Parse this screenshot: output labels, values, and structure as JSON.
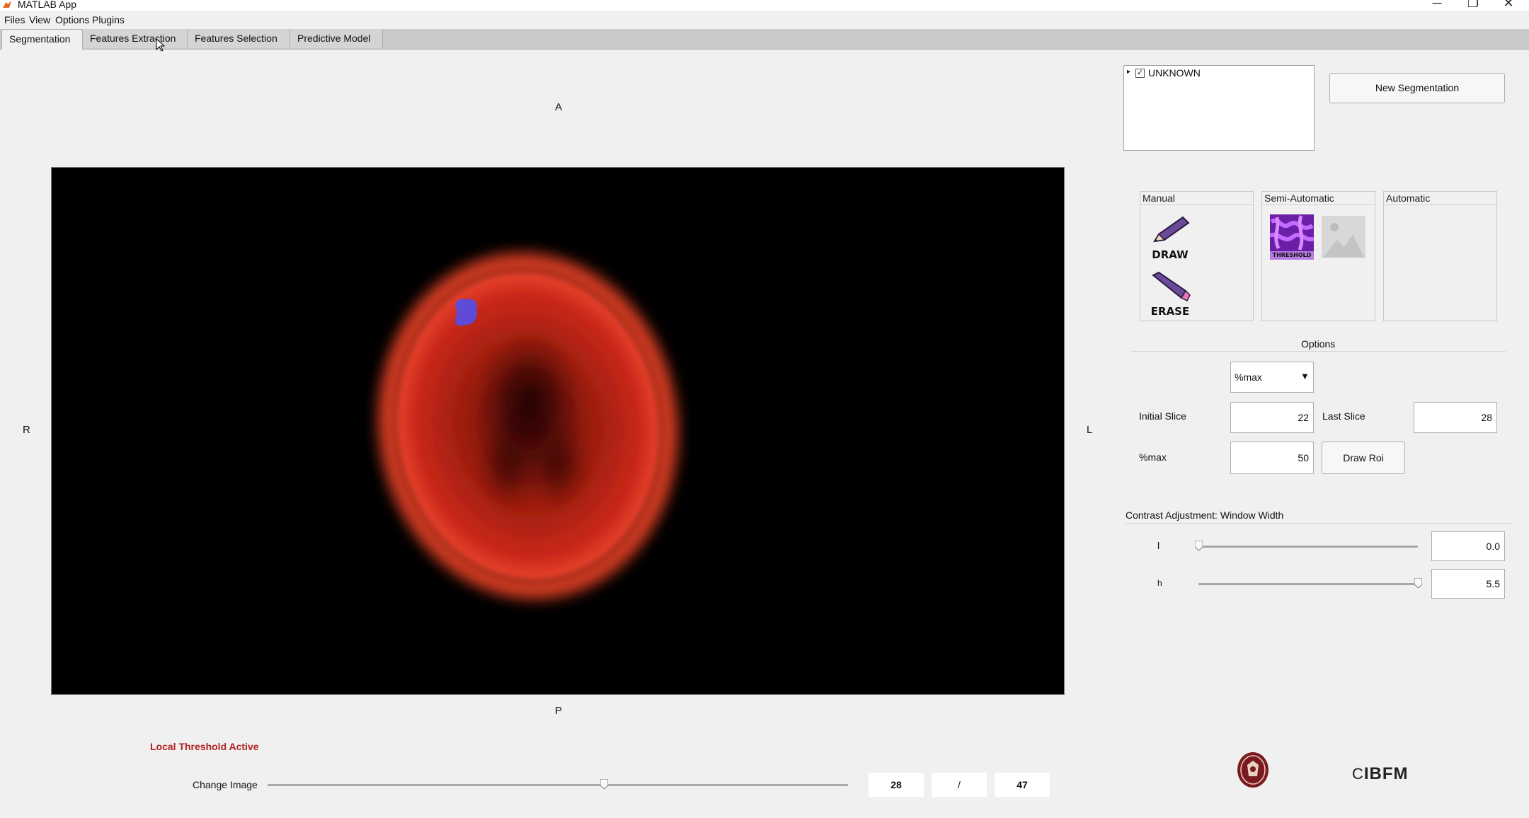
{
  "window": {
    "title": "MATLAB App",
    "minimize_glyph": "─",
    "restore_glyph": "❐",
    "close_glyph": "✕"
  },
  "menu": [
    "Files",
    "View",
    "Options",
    "Plugins"
  ],
  "tabs": [
    {
      "label": "Segmentation",
      "active": true
    },
    {
      "label": "Features Extraction",
      "active": false
    },
    {
      "label": "Features Selection",
      "active": false
    },
    {
      "label": "Predictive Model",
      "active": false
    }
  ],
  "viewer": {
    "top_label": "A",
    "bottom_label": "P",
    "left_label": "R",
    "right_label": "L"
  },
  "tree": {
    "item_label": "UNKNOWN",
    "checked": true
  },
  "new_segmentation_label": "New Segmentation",
  "tools": {
    "manual_title": "Manual",
    "semi_title": "Semi-Automatic",
    "auto_title": "Automatic",
    "draw_label": "DRAW",
    "erase_label": "ERASE",
    "threshold_label": "THRESHOLD"
  },
  "options": {
    "title": "Options",
    "mode_selected": "%max",
    "initial_slice_label": "Initial Slice",
    "initial_slice_value": "22",
    "last_slice_label": "Last Slice",
    "last_slice_value": "28",
    "pmax_label": "%max",
    "pmax_value": "50",
    "draw_roi_label": "Draw Roi"
  },
  "contrast": {
    "title": "Contrast Adjustment: Window Width",
    "low_label": "l",
    "low_value": "0.0",
    "low_position": 0.0,
    "high_label": "h",
    "high_value": "5.5",
    "high_position": 1.0
  },
  "status": {
    "text": "Local Threshold Active",
    "color": "#b22222"
  },
  "navigation": {
    "label": "Change Image",
    "current": "28",
    "separator": "/",
    "total": "47",
    "position": 0.58
  },
  "logos": {
    "ibfm_text": "IBFM",
    "ibfm_mark": "C"
  },
  "colors": {
    "accent_status": "#b22222",
    "pet_red": "#d42a1a",
    "roi_blue": "#5a4de0",
    "threshold_purple": "#8b2fc9"
  }
}
